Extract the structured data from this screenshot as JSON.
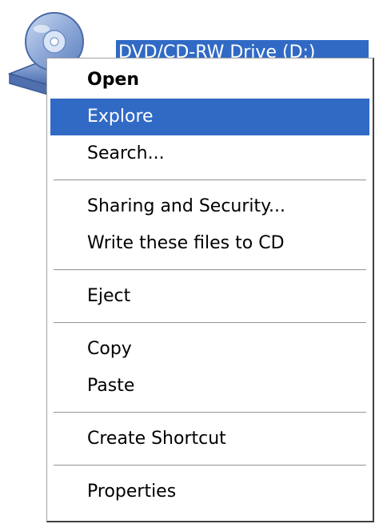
{
  "drive": {
    "label": "DVD/CD-RW Drive (D:)",
    "icon": "cd-drive-icon"
  },
  "colors": {
    "highlight": "#316ac5",
    "highlight_text": "#ffffff",
    "menu_bg": "#ffffff",
    "separator": "#9a9a9a"
  },
  "context_menu": {
    "items": [
      {
        "label": "Open",
        "default": true
      },
      {
        "label": "Explore",
        "selected": true
      },
      {
        "label": "Search..."
      },
      {
        "label": "Sharing and Security..."
      },
      {
        "label": "Write these files to CD"
      },
      {
        "label": "Eject"
      },
      {
        "label": "Copy"
      },
      {
        "label": "Paste"
      },
      {
        "label": "Create Shortcut"
      },
      {
        "label": "Properties"
      }
    ]
  }
}
